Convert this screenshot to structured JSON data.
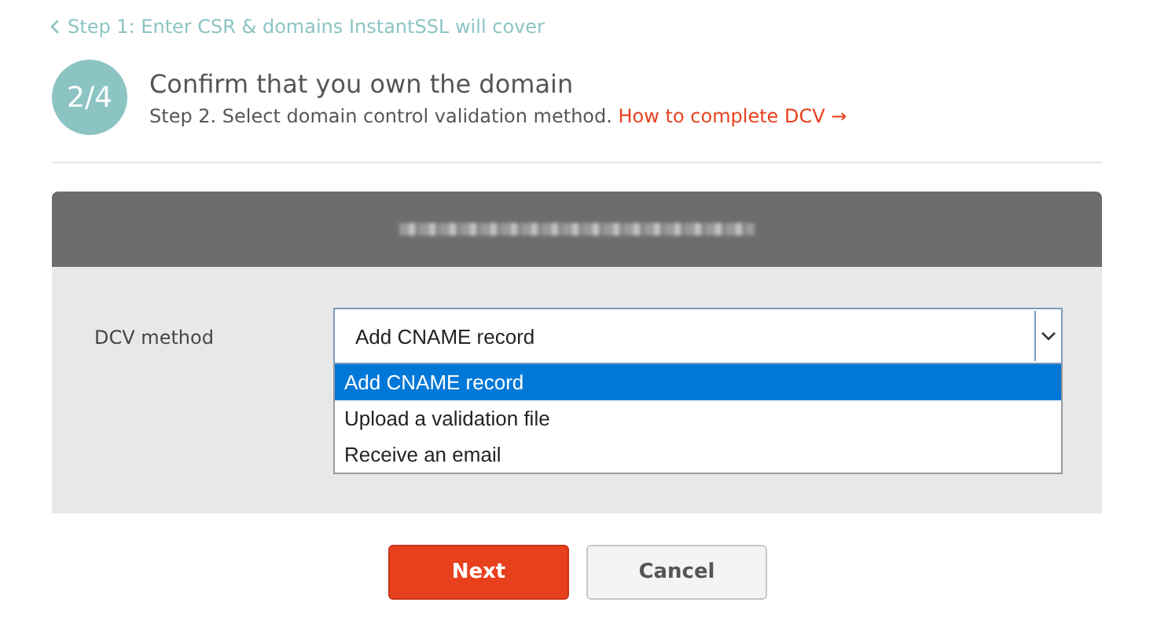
{
  "back_link": "Step 1: Enter CSR & domains InstantSSL will cover",
  "step": {
    "badge": "2/4",
    "title": "Confirm that you own the domain",
    "subtitle": "Step 2. Select domain control validation method.",
    "help_link": "How to complete DCV →"
  },
  "panel": {
    "field_label": "DCV method",
    "select": {
      "value": "Add CNAME record",
      "expanded": true,
      "options": [
        {
          "label": "Add CNAME record",
          "selected": true
        },
        {
          "label": "Upload a validation file",
          "selected": false
        },
        {
          "label": "Receive an email",
          "selected": false
        }
      ]
    }
  },
  "buttons": [
    {
      "label": "Next",
      "kind": "primary"
    },
    {
      "label": "Cancel",
      "kind": "secondary"
    }
  ]
}
